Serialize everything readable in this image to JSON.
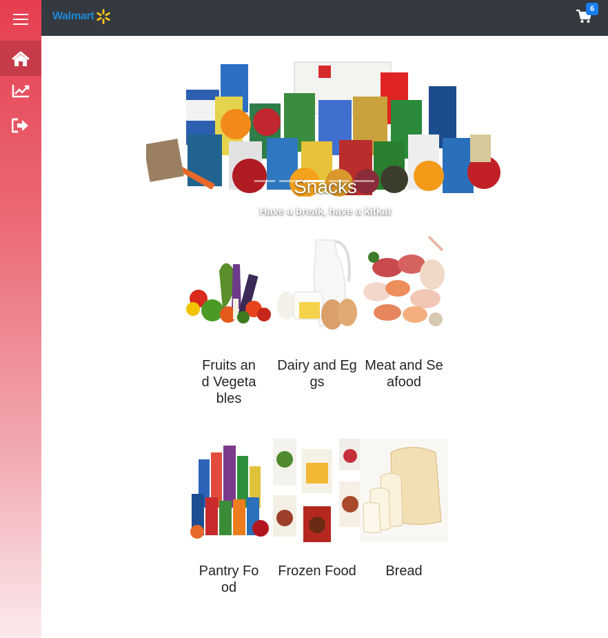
{
  "brand": {
    "name": "Walmart",
    "icon": "walmart-spark-icon",
    "color": "#1e88d6",
    "spark_color": "#ffc220"
  },
  "sidebar": {
    "items": [
      {
        "name": "menu",
        "icon": "hamburger-menu-icon"
      },
      {
        "name": "home",
        "icon": "home-icon",
        "active": true
      },
      {
        "name": "stats",
        "icon": "chart-line-icon"
      },
      {
        "name": "logout",
        "icon": "sign-out-icon"
      }
    ],
    "gradient_top": "#e53e4f",
    "active_bg": "#c63b49"
  },
  "topbar": {
    "bg": "#343a40"
  },
  "cart": {
    "icon": "shopping-cart-icon",
    "count": "6",
    "badge_color": "#1a7df0"
  },
  "carousel": {
    "title": "Snacks",
    "subtitle": "Have a break, have a kitkat",
    "slides": 5,
    "active_slide": 3
  },
  "categories": [
    {
      "label": "Fruits and Vegetables",
      "image": "fruits-vegetables"
    },
    {
      "label": "Dairy and Eggs",
      "image": "dairy-eggs"
    },
    {
      "label": "Meat and Seafood",
      "image": "meat-seafood"
    },
    {
      "label": "Pantry Food",
      "image": "pantry-food"
    },
    {
      "label": "Frozen Food",
      "image": "frozen-food"
    },
    {
      "label": "Bread",
      "image": "bread"
    }
  ]
}
